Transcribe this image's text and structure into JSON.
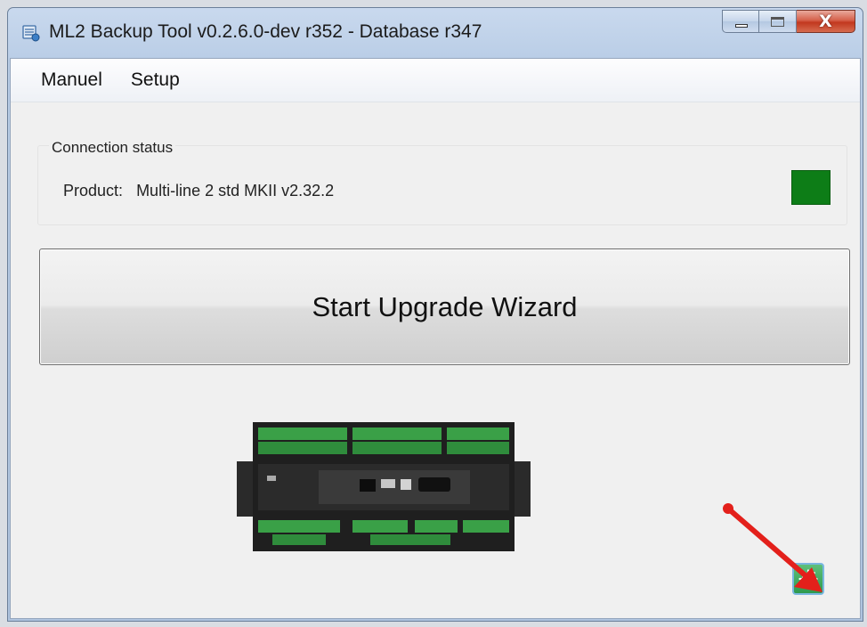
{
  "window": {
    "title": "ML2 Backup Tool v0.2.6.0-dev r352 - Database r347",
    "app_icon": "database-icon",
    "caption": {
      "minimize": "minimize-icon",
      "maximize": "maximize-icon",
      "close_glyph": "X"
    }
  },
  "menu": {
    "items": [
      {
        "label": "Manuel"
      },
      {
        "label": "Setup"
      }
    ]
  },
  "connection": {
    "group_title": "Connection status",
    "product_label": "Product:",
    "product_value": "Multi-line 2 std MKII v2.32.2",
    "status_color": "#0d7d17"
  },
  "wizard": {
    "label": "Start Upgrade Wizard"
  },
  "device_image": {
    "icon": "controller-device-image"
  },
  "settings_button": {
    "icon": "gear-icon",
    "color": "#2e9a4e"
  },
  "annotation": {
    "icon": "red-arrow-icon",
    "color": "#e3201b"
  }
}
